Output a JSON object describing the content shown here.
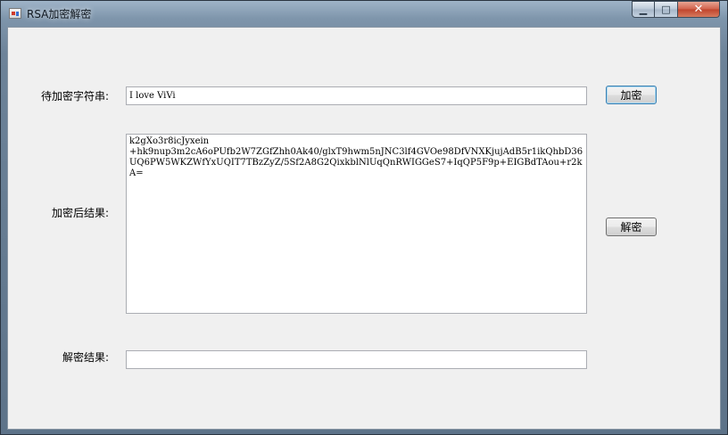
{
  "window": {
    "title": "RSA加密解密",
    "icon": "app-icon",
    "controls": {
      "minimize": "▁",
      "maximize": "□",
      "close": "✕"
    }
  },
  "form": {
    "plain_label": "待加密字符串:",
    "plain_value": "I love ViVi",
    "encrypt_button": "加密",
    "cipher_label": "加密后结果:",
    "cipher_value": "k2gXo3r8icJyxein\n+hk9nup3m2cA6oPUfb2W7ZGfZhh0Ak40/glxT9hwm5nJNC3lf4GVOe98DfVNXKjujAdB5r1ikQhbD36UQ6PW5WKZWfYxUQIT7TBzZyZ/5Sf2A8G2QixkblNlUqQnRWIGGeS7+IqQP5F9p+EIGBdTAou+r2kA=",
    "decrypt_button": "解密",
    "decrypted_label": "解密结果:",
    "decrypted_value": ""
  }
}
